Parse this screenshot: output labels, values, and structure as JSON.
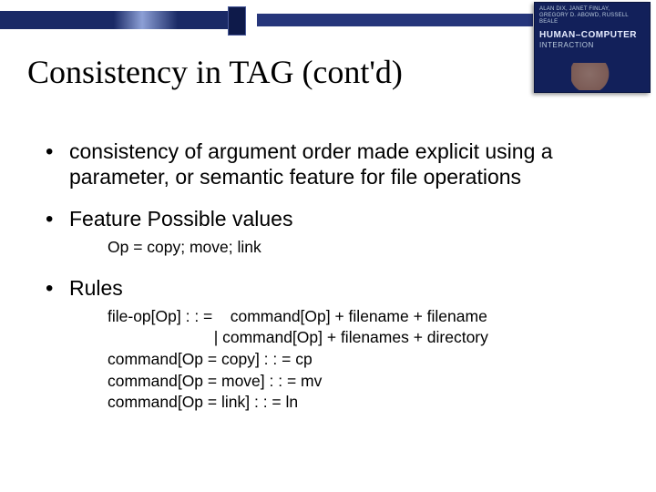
{
  "book": {
    "authors": "ALAN DIX, JANET FINLAY,\nGREGORY D. ABOWD, RUSSELL BEALE",
    "title": "HUMAN–COMPUTER",
    "subtitle": "INTERACTION"
  },
  "slide": {
    "title": "Consistency in TAG (cont'd)",
    "bullets": [
      {
        "text": "consistency of argument order made explicit using a parameter, or semantic feature for file operations"
      },
      {
        "text": "Feature Possible values",
        "sub": [
          "Op = copy; move; link"
        ]
      },
      {
        "text": "Rules",
        "sub": [
          "file-op[Op] : : =    command[Op] + filename + filename",
          "                        | command[Op] + filenames + directory",
          "command[Op = copy] : : = cp",
          "command[Op = move] : : = mv",
          "command[Op = link] : : = ln"
        ]
      }
    ]
  }
}
